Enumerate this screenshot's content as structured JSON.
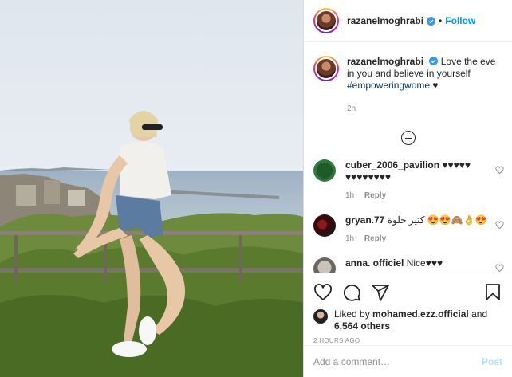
{
  "post": {
    "author": "razanelmoghrabi",
    "follow_label": "Follow",
    "dot": "•"
  },
  "caption": {
    "author": "razanelmoghrabi",
    "text": "Love the eve in you and believe in yourself",
    "hashtag": "#empoweringwome",
    "heart": "♥",
    "time": "2h"
  },
  "comments": [
    {
      "author": "cuber_2006_pavilion",
      "text": "♥♥♥♥♥ ♥♥♥♥♥♥♥♥",
      "time": "1h",
      "reply": "Reply"
    },
    {
      "author": "gryan.77",
      "text": "كتير حلوة 😍😍🙈👌😍",
      "time": "1h",
      "reply": "Reply"
    },
    {
      "author": "anna. officiel",
      "text": "Nice♥♥♥",
      "time": "",
      "reply": ""
    }
  ],
  "likes": {
    "prefix": "Liked by",
    "user": "mohamed.ezz.official",
    "connector": "and",
    "others": "6,564 others"
  },
  "posted_ago": "2 HOURS AGO",
  "add_comment": {
    "placeholder": "Add a comment…",
    "post_label": "Post"
  },
  "colors": {
    "accent": "#0095f6",
    "post_disabled": "#b2dffc",
    "hashtag": "#00376b",
    "muted": "#8e8e8e"
  },
  "icons": [
    "verified-badge-icon",
    "load-more-icon",
    "heart-icon",
    "comment-icon",
    "share-icon",
    "bookmark-icon"
  ]
}
